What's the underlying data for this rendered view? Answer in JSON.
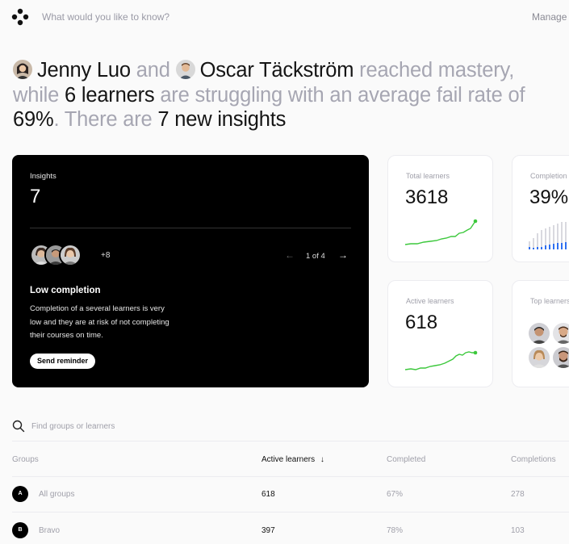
{
  "topbar": {
    "ask_placeholder": "What would you like to know?",
    "manage_label": "Manage"
  },
  "headline": {
    "person1": "Jenny Luo",
    "and": "and",
    "person2": "Oscar Täckström",
    "reached": "reached mastery,",
    "while": "while",
    "learners": "6 learners",
    "struggling": "are struggling with an average fail rate",
    "of": "of",
    "rate": "69%",
    "there_are": ". There are",
    "insights": "7 new insights"
  },
  "insights_card": {
    "label": "Insights",
    "count": "7",
    "more_count": "+8",
    "pager": "1 of 4",
    "title": "Low completion",
    "description": "Completion of a several learners is very low and they are at risk of not completing their courses on time.",
    "button": "Send reminder"
  },
  "stats": {
    "total_label": "Total learners",
    "total_value": "3618",
    "active_label": "Active learners",
    "active_value": "618",
    "completion_label": "Completion",
    "completion_value": "39%",
    "top_label": "Top learners"
  },
  "colors": {
    "accent_green": "#3cc83c",
    "accent_blue": "#2f6ff0"
  },
  "search": {
    "placeholder": "Find groups or learners"
  },
  "table": {
    "headers": [
      "Groups",
      "Active learners",
      "Completed",
      "Completions"
    ],
    "sort_indicator": "↓",
    "rows": [
      {
        "badge": "A",
        "name": "All groups",
        "active": "618",
        "completed": "67%",
        "completions": "278"
      },
      {
        "badge": "B",
        "name": "Bravo",
        "active": "397",
        "completed": "78%",
        "completions": "103"
      }
    ]
  }
}
